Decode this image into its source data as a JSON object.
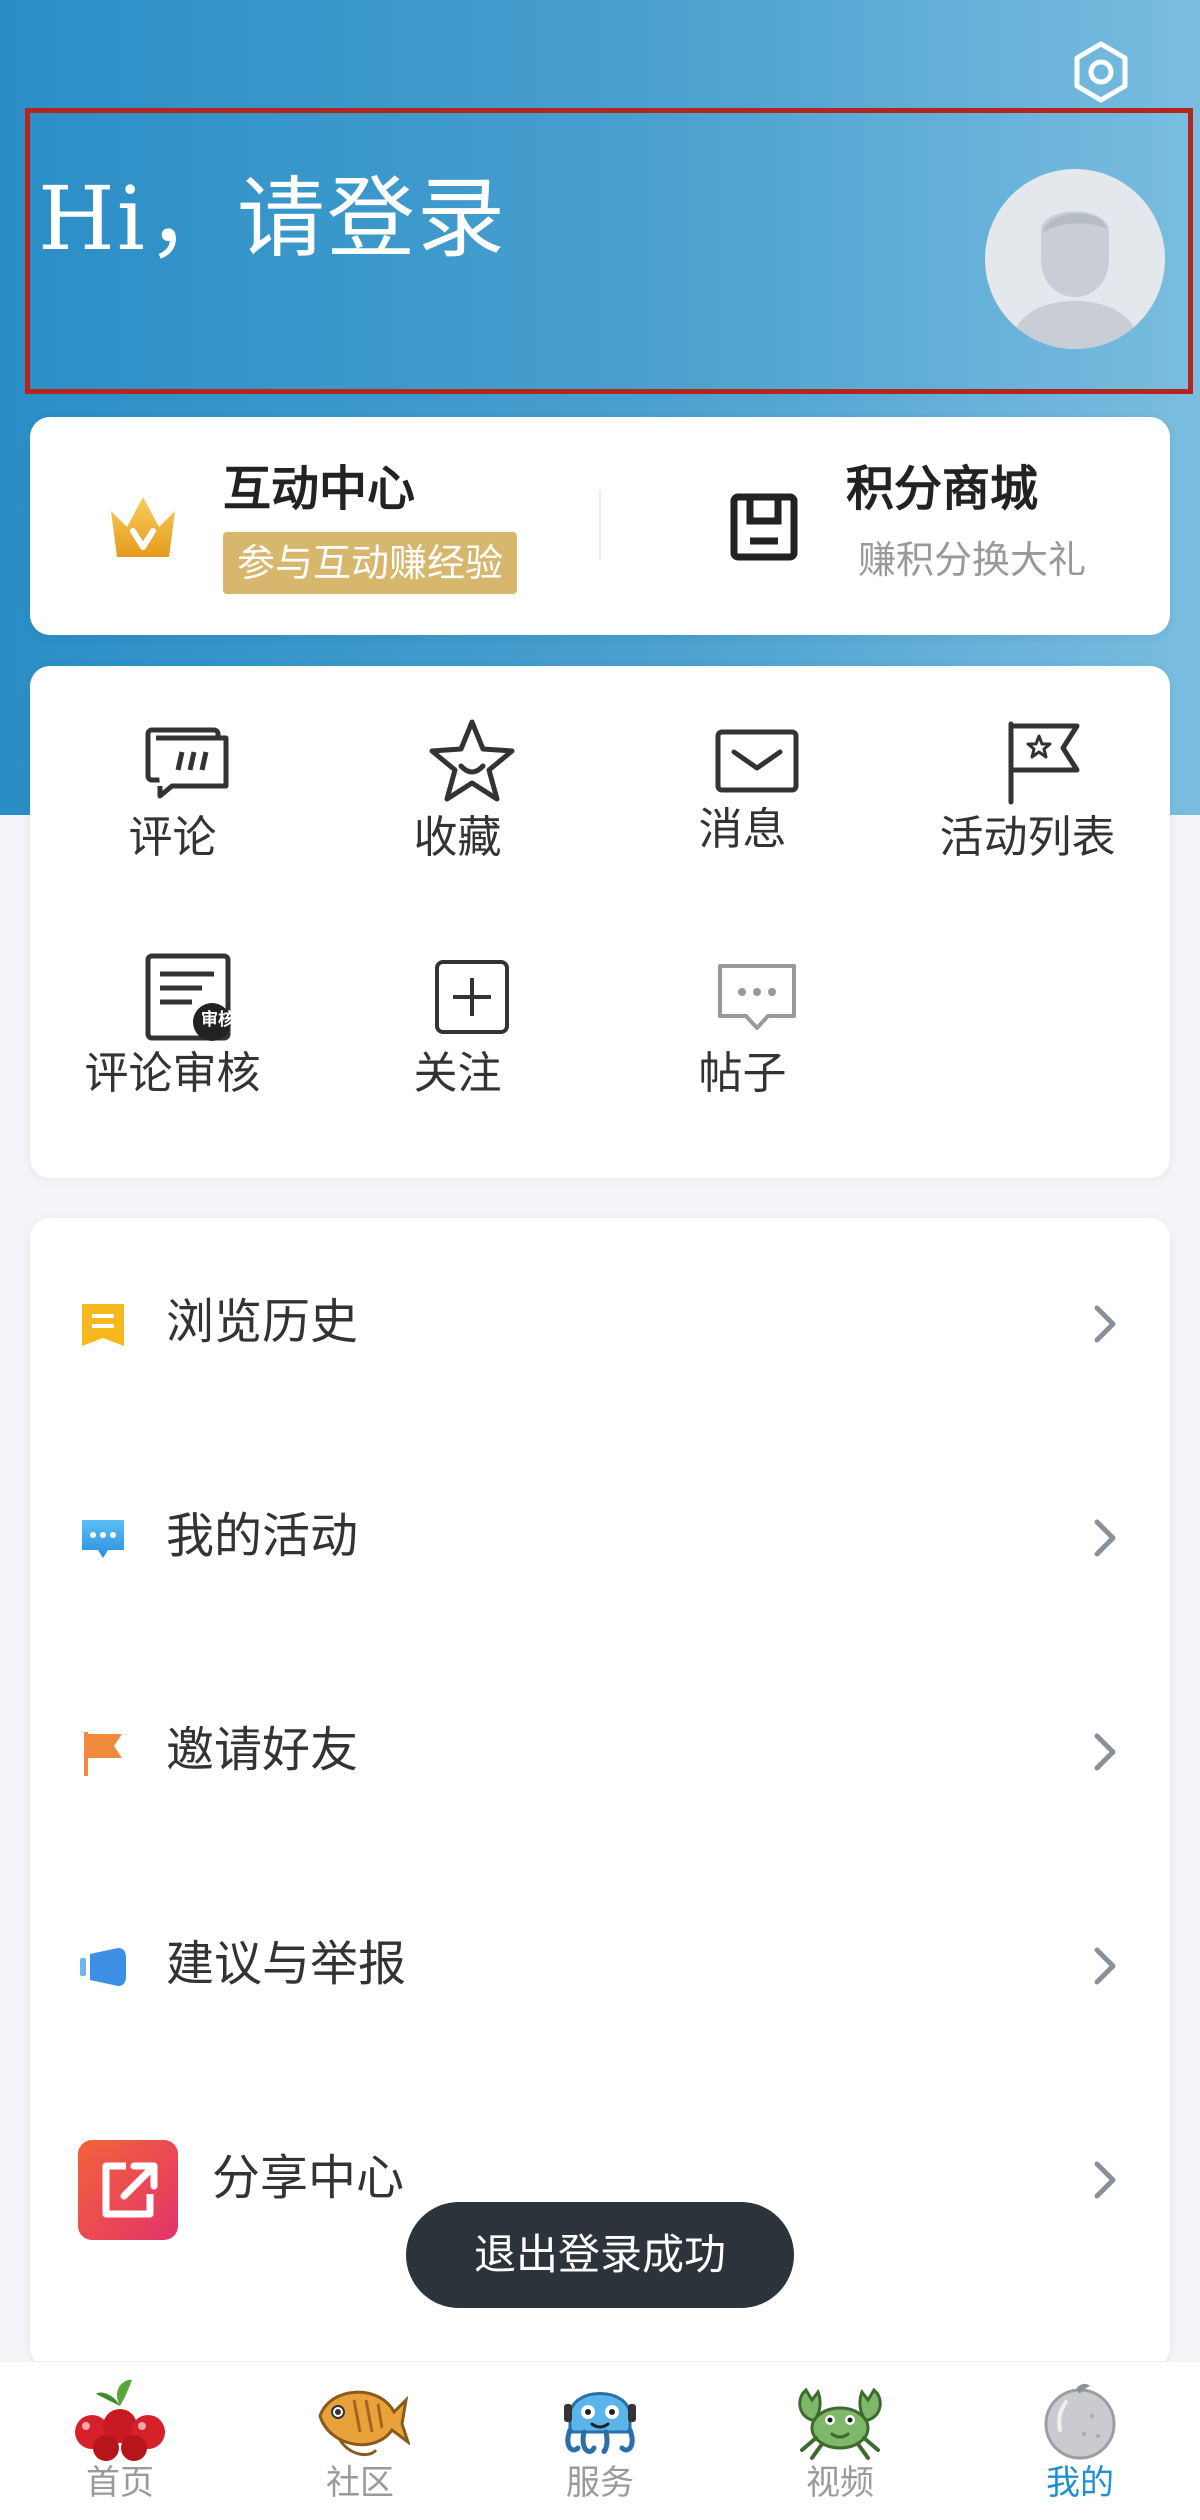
{
  "header": {
    "greeting": "Hi，请登录"
  },
  "promo": {
    "interaction_center": {
      "title": "互动中心",
      "badge": "参与互动赚经验"
    },
    "points_mall": {
      "title": "积分商城",
      "subtitle": "赚积分换大礼"
    }
  },
  "grid": {
    "items": [
      {
        "label": "评论",
        "icon": "comment-icon"
      },
      {
        "label": "收藏",
        "icon": "star-icon"
      },
      {
        "label": "消息",
        "icon": "mail-icon"
      },
      {
        "label": "活动列表",
        "icon": "flag-icon"
      },
      {
        "label": "评论审核",
        "icon": "review-icon",
        "badge": "审核"
      },
      {
        "label": "关注",
        "icon": "plus-square-icon"
      },
      {
        "label": "帖子",
        "icon": "chat-bubble-icon"
      }
    ]
  },
  "list": {
    "items": [
      {
        "label": "浏览历史",
        "icon": "history-icon"
      },
      {
        "label": "我的活动",
        "icon": "activity-icon"
      },
      {
        "label": "邀请好友",
        "icon": "invite-flag-icon"
      },
      {
        "label": "建议与举报",
        "icon": "report-icon"
      },
      {
        "label": "分享中心",
        "icon": "share-icon"
      }
    ]
  },
  "toast": {
    "message": "退出登录成功"
  },
  "tabbar": {
    "tabs": [
      {
        "label": "首页",
        "icon": "cherries-icon"
      },
      {
        "label": "社区",
        "icon": "fish-icon"
      },
      {
        "label": "服务",
        "icon": "octopus-icon"
      },
      {
        "label": "视频",
        "icon": "crab-icon"
      },
      {
        "label": "我的",
        "icon": "gray-fruit-icon"
      }
    ],
    "active_index": 4
  },
  "colors": {
    "header_gradient_start": "#2a8ec6",
    "header_gradient_end": "#7abde0",
    "badge_gold": "#d7b66e",
    "active_tab": "#1f8fd4",
    "highlight_border": "#b3261e"
  }
}
